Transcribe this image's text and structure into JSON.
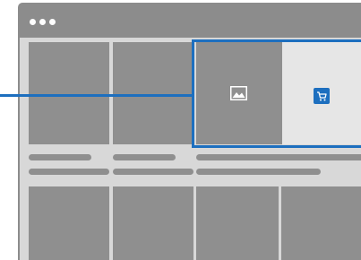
{
  "browser": {
    "window_controls": [
      "dot",
      "dot",
      "dot"
    ]
  },
  "icons": {
    "image": "image-icon",
    "cart": "shopping-cart-icon"
  },
  "colors": {
    "frame": "#8c8c8c",
    "content_bg": "#d8d8d8",
    "placeholder": "#8f8f8f",
    "highlight_panel": "#e6e6e6",
    "accent": "#1d6fbf",
    "background": "#ffffff"
  }
}
